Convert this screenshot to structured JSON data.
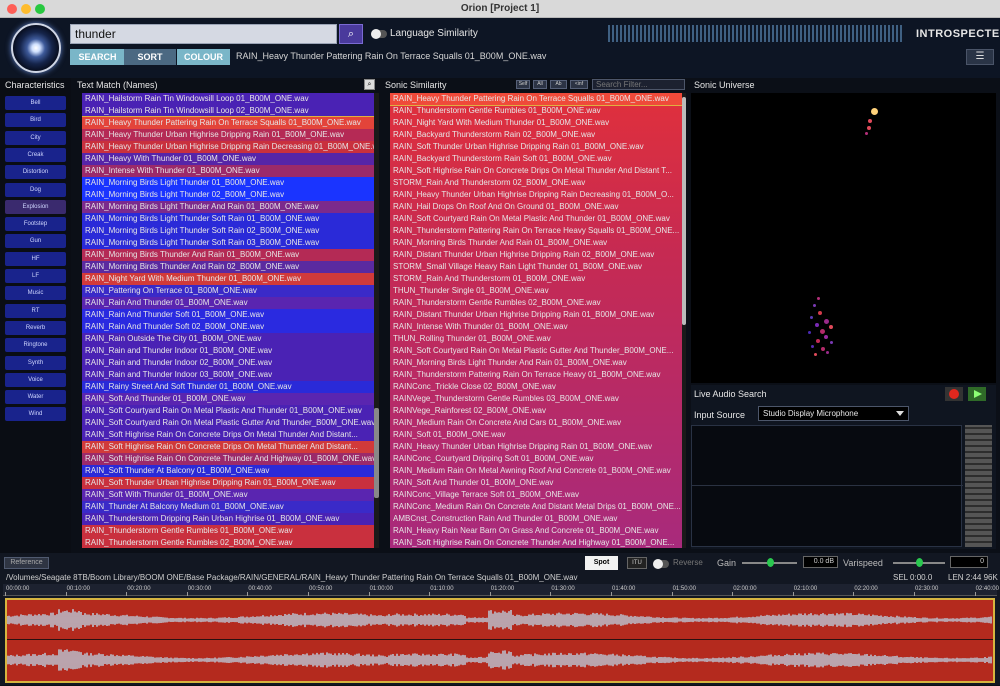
{
  "window": {
    "title": "Orion [Project 1]"
  },
  "topbar": {
    "search_value": "thunder",
    "search_icon": "telescope-icon",
    "language_similarity": "Language Similarity",
    "brand": "INTROSPECTER",
    "tabs": [
      "SEARCH",
      "SORT",
      "COLOUR"
    ],
    "selected_file": "RAIN_Heavy Thunder Pattering Rain On Terrace Squalls 01_B00M_ONE.wav",
    "menu_icon": "list-menu-icon"
  },
  "characteristics": {
    "title": "Characteristics",
    "items": [
      "Bell",
      "Bird",
      "City",
      "Creak",
      "Distortion",
      "Dog",
      "Explosion",
      "Footstep",
      "Gun",
      "HF",
      "LF",
      "Music",
      "RT",
      "Reverb",
      "Ringtone",
      "Synth",
      "Voice",
      "Water",
      "Wind"
    ],
    "active": "Explosion"
  },
  "text_match": {
    "title": "Text Match (Names)",
    "selected_index": 2,
    "items": [
      {
        "name": "RAIN_Hailstorm Rain Tin Windowsill Loop 01_B00M_ONE.wav",
        "color": "#4a22b4"
      },
      {
        "name": "RAIN_Hailstorm Rain Tin Windowsill Loop 02_B00M_ONE.wav",
        "color": "#4a22b4"
      },
      {
        "name": "RAIN_Heavy Thunder Pattering Rain On Terrace Squalls 01_B00M_ONE.wav",
        "color": "#e3443a"
      },
      {
        "name": "RAIN_Heavy Thunder Urban Highrise Dripping Rain 01_B00M_ONE.wav",
        "color": "#b52a55"
      },
      {
        "name": "RAIN_Heavy Thunder Urban Highrise Dripping Rain Decreasing 01_B00M_ONE.wav",
        "color": "#c9303e"
      },
      {
        "name": "RAIN_Heavy With Thunder 01_B00M_ONE.wav",
        "color": "#5625a8"
      },
      {
        "name": "RAIN_Intense With Thunder 01_B00M_ONE.wav",
        "color": "#9b2a6a"
      },
      {
        "name": "RAIN_Morning Birds Light Thunder 01_B00M_ONE.wav",
        "color": "#1a34ff"
      },
      {
        "name": "RAIN_Morning Birds Light Thunder 02_B00M_ONE.wav",
        "color": "#1a34ff"
      },
      {
        "name": "RAIN_Morning Birds Light Thunder And Rain 01_B00M_ONE.wav",
        "color": "#7b2a8c"
      },
      {
        "name": "RAIN_Morning Birds Light Thunder Soft Rain 01_B00M_ONE.wav",
        "color": "#2a2ad8"
      },
      {
        "name": "RAIN_Morning Birds Light Thunder Soft Rain 02_B00M_ONE.wav",
        "color": "#2a2ad8"
      },
      {
        "name": "RAIN_Morning Birds Light Thunder Soft Rain 03_B00M_ONE.wav",
        "color": "#2a2ad8"
      },
      {
        "name": "RAIN_Morning Birds Thunder And Rain 01_B00M_ONE.wav",
        "color": "#b42a55"
      },
      {
        "name": "RAIN_Morning Birds Thunder And Rain 02_B00M_ONE.wav",
        "color": "#5a2aa0"
      },
      {
        "name": "RAIN_Night Yard With Medium Thunder 01_B00M_ONE.wav",
        "color": "#d13a3a"
      },
      {
        "name": "RAIN_Pattering On Terrace 01_B00M_ONE.wav",
        "color": "#3a2ac8"
      },
      {
        "name": "RAIN_Rain And Thunder 01_B00M_ONE.wav",
        "color": "#5a25b0"
      },
      {
        "name": "RAIN_Rain And Thunder Soft 01_B00M_ONE.wav",
        "color": "#2a2ae0"
      },
      {
        "name": "RAIN_Rain And Thunder Soft 02_B00M_ONE.wav",
        "color": "#2a2ae0"
      },
      {
        "name": "RAIN_Rain Outside The City 01_B00M_ONE.wav",
        "color": "#4a22b4"
      },
      {
        "name": "RAIN_Rain and Thunder Indoor 01_B00M_ONE.wav",
        "color": "#4a22b4"
      },
      {
        "name": "RAIN_Rain and Thunder Indoor 02_B00M_ONE.wav",
        "color": "#4a22b4"
      },
      {
        "name": "RAIN_Rain and Thunder Indoor 03_B00M_ONE.wav",
        "color": "#4a22b4"
      },
      {
        "name": "RAIN_Rainy Street And Soft Thunder 01_B00M_ONE.wav",
        "color": "#2a2ad8"
      },
      {
        "name": "RAIN_Soft And Thunder 01_B00M_ONE.wav",
        "color": "#5a25b0"
      },
      {
        "name": "RAIN_Soft Courtyard Rain On Metal Plastic And Thunder 01_B00M_ONE.wav",
        "color": "#4a22b4"
      },
      {
        "name": "RAIN_Soft Courtyard Rain On Metal Plastic Gutter And Thunder_B00M_ONE.wav",
        "color": "#4a22b4"
      },
      {
        "name": "RAIN_Soft Highrise Rain On Concrete Drips On Metal Thunder And Distant...",
        "color": "#4a22b4"
      },
      {
        "name": "RAIN_Soft Highrise Rain On Concrete Drips On Metal Thunder And Distant...",
        "color": "#d13a3a"
      },
      {
        "name": "RAIN_Soft Highrise Rain On Concrete Thunder And Highway 01_B00M_ONE.wav",
        "color": "#9b2a6a"
      },
      {
        "name": "RAIN_Soft Thunder At Balcony 01_B00M_ONE.wav",
        "color": "#2a2ad8"
      },
      {
        "name": "RAIN_Soft Thunder Urban Highrise Dripping Rain 01_B00M_ONE.wav",
        "color": "#c9303e"
      },
      {
        "name": "RAIN_Soft With Thunder 01_B00M_ONE.wav",
        "color": "#5a25b0"
      },
      {
        "name": "RAIN_Thunder At Balcony Medium 01_B00M_ONE.wav",
        "color": "#3a2ac8"
      },
      {
        "name": "RAIN_Thunderstorm Dripping Rain Urban Highrise 01_B00M_ONE.wav",
        "color": "#4a22b4"
      },
      {
        "name": "RAIN_Thunderstorm Gentle Rumbles 01_B00M_ONE.wav",
        "color": "#c9303e"
      },
      {
        "name": "RAIN_Thunderstorm Gentle Rumbles 02_B00M_ONE.wav",
        "color": "#c9303e"
      }
    ]
  },
  "sonic_similarity": {
    "title": "Sonic Similarity",
    "buttons": [
      "Self",
      "All",
      "Ab",
      "<inf"
    ],
    "filter_placeholder": "Search Filter...",
    "items": [
      "RAIN_Heavy Thunder Pattering Rain On Terrace Squalls 01_B00M_ONE.wav",
      "RAIN_Thunderstorm Gentle Rumbles 01_B00M_ONE.wav",
      "RAIN_Night Yard With Medium Thunder 01_B00M_ONE.wav",
      "RAIN_Backyard Thunderstorm Rain 02_B00M_ONE.wav",
      "RAIN_Soft Thunder Urban Highrise Dripping Rain 01_B00M_ONE.wav",
      "RAIN_Backyard Thunderstorm Rain Soft 01_B00M_ONE.wav",
      "RAIN_Soft Highrise Rain On Concrete Drips On Metal Thunder And Distant T...",
      "STORM_Rain And Thunderstorm 02_B00M_ONE.wav",
      "RAIN_Heavy Thunder Urban Highrise Dripping Rain Decreasing 01_B00M_O...",
      "RAIN_Hail Drops On Roof And On Ground 01_B00M_ONE.wav",
      "RAIN_Soft Courtyard Rain On Metal Plastic And Thunder 01_B00M_ONE.wav",
      "RAIN_Thunderstorm Pattering Rain On Terrace Heavy Squalls 01_B00M_ONE...",
      "RAIN_Morning Birds Thunder And Rain 01_B00M_ONE.wav",
      "RAIN_Distant Thunder Urban Highrise Dripping Rain 02_B00M_ONE.wav",
      "STORM_Small Village Heavy Rain Light Thunder 01_B00M_ONE.wav",
      "STORM_Rain And Thunderstorm 01_B00M_ONE.wav",
      "THUN_Thunder Single 01_B00M_ONE.wav",
      "RAIN_Thunderstorm Gentle Rumbles 02_B00M_ONE.wav",
      "RAIN_Distant Thunder Urban Highrise Dripping Rain 01_B00M_ONE.wav",
      "RAIN_Intense With Thunder 01_B00M_ONE.wav",
      "THUN_Rolling Thunder 01_B00M_ONE.wav",
      "RAIN_Soft Courtyard Rain On Metal Plastic Gutter And Thunder_B00M_ONE...",
      "RAIN_Morning Birds Light Thunder And Rain 01_B00M_ONE.wav",
      "RAIN_Thunderstorm Pattering Rain On Terrace Heavy 01_B00M_ONE.wav",
      "RAINConc_Trickle Close 02_B00M_ONE.wav",
      "RAINVege_Thunderstorm Gentle Rumbles 03_B00M_ONE.wav",
      "RAINVege_Rainforest 02_B00M_ONE.wav",
      "RAIN_Medium Rain On Concrete And Cars 01_B00M_ONE.wav",
      "RAIN_Soft 01_B00M_ONE.wav",
      "RAIN_Heavy Thunder Urban Highrise Dripping Rain 01_B00M_ONE.wav",
      "RAINConc_Courtyard Dripping Soft 01_B00M_ONE.wav",
      "RAIN_Medium Rain On Metal Awning Roof And Concrete 01_B00M_ONE.wav",
      "RAIN_Soft And Thunder 01_B00M_ONE.wav",
      "RAINConc_Village Terrace Soft 01_B00M_ONE.wav",
      "RAINConc_Medium Rain On Concrete And Distant Metal Drips 01_B00M_ONE...",
      "AMBCnst_Construction Rain And Thunder 01_B00M_ONE.wav",
      "RAIN_Heavy Rain Near Barn On Grass And Concrete 01_B00M_ONE.wav",
      "RAIN_Soft Highrise Rain On Concrete Thunder And Highway 01_B00M_ONE..."
    ]
  },
  "universe": {
    "title": "Sonic Universe"
  },
  "live_audio": {
    "title": "Live Audio Search",
    "input_label": "Input Source",
    "input_value": "Studio Display Microphone"
  },
  "transport": {
    "reference": "Reference",
    "spot": "Spot",
    "itu": "ITU",
    "reverse": "Reverse",
    "gain_label": "Gain",
    "gain_value": "0.0 dB",
    "gain_level": 0.5,
    "varispeed_label": "Varispeed",
    "varispeed_value": "0",
    "varispeed_level": 0.5,
    "path": "/Volumes/Seagate 8TB/Boom Library/BOOM ONE/Base Package/RAIN/GENERAL/RAIN_Heavy Thunder Pattering Rain On Terrace Squalls 01_B00M_ONE.wav",
    "sel": "SEL 0:00.0",
    "len": "LEN 2:44",
    "rate": "96K",
    "ticks": [
      "00:00:00",
      "00:10:00",
      "00:20:00",
      "00:30:00",
      "00:40:00",
      "00:50:00",
      "01:00:00",
      "01:10:00",
      "01:20:00",
      "01:30:00",
      "01:40:00",
      "01:50:00",
      "02:00:00",
      "02:10:00",
      "02:20:00",
      "02:30:00",
      "02:40:00"
    ]
  }
}
